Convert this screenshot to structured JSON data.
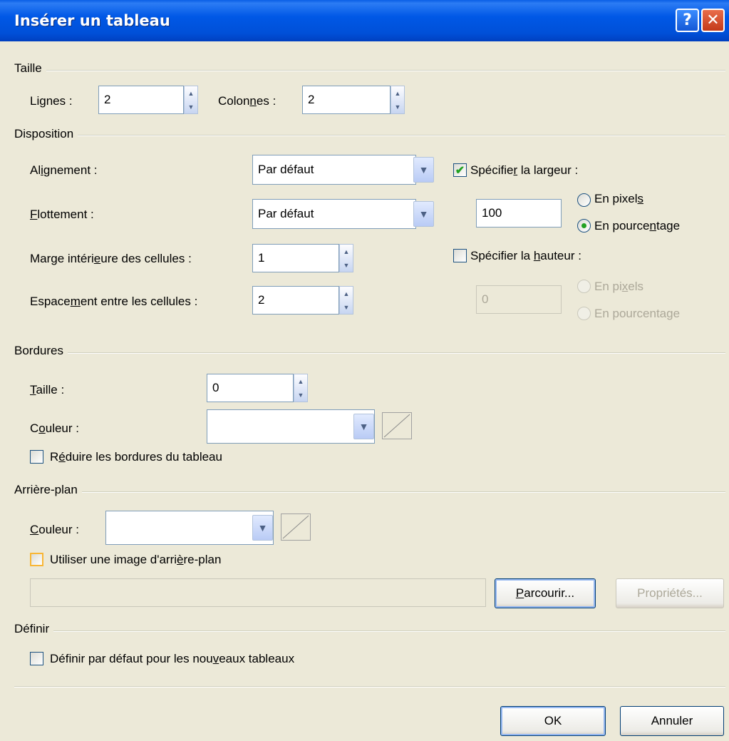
{
  "window": {
    "title": "Insérer un tableau",
    "help_glyph": "?",
    "close_glyph": "✕"
  },
  "size": {
    "group_title": "Taille",
    "rows_label": "Lignes :",
    "rows_value": "2",
    "cols_label": "Colonnes :",
    "cols_value": "2"
  },
  "layout": {
    "group_title": "Disposition",
    "alignment_label": "Alignement :",
    "alignment_value": "Par défaut",
    "float_label": "Flottement :",
    "float_value": "Par défaut",
    "padding_label": "Marge intérieure des cellules :",
    "padding_value": "1",
    "spacing_label": "Espacement entre les cellules :",
    "spacing_value": "2",
    "width_check_label": "Spécifier la largeur :",
    "width_checked": true,
    "width_value": "100",
    "width_px_label": "En pixels",
    "width_pct_label": "En pourcentage",
    "height_check_label": "Spécifier la hauteur :",
    "height_checked": false,
    "height_value": "0",
    "height_px_label": "En pixels",
    "height_pct_label": "En pourcentage"
  },
  "borders": {
    "group_title": "Bordures",
    "size_label": "Taille :",
    "size_value": "0",
    "color_label": "Couleur :",
    "collapse_label": "Réduire les bordures du tableau"
  },
  "background": {
    "group_title": "Arrière-plan",
    "color_label": "Couleur :",
    "use_image_label": "Utiliser une image d'arrière-plan",
    "browse_label": "Parcourir...",
    "properties_label": "Propriétés..."
  },
  "define": {
    "group_title": "Définir",
    "default_label": "Définir par défaut pour les nouveaux tableaux"
  },
  "footer": {
    "ok_label": "OK",
    "cancel_label": "Annuler"
  },
  "colors": {
    "titlebar": "#0058e6",
    "dialog_bg": "#ece9d8",
    "check_green": "#21a121"
  }
}
